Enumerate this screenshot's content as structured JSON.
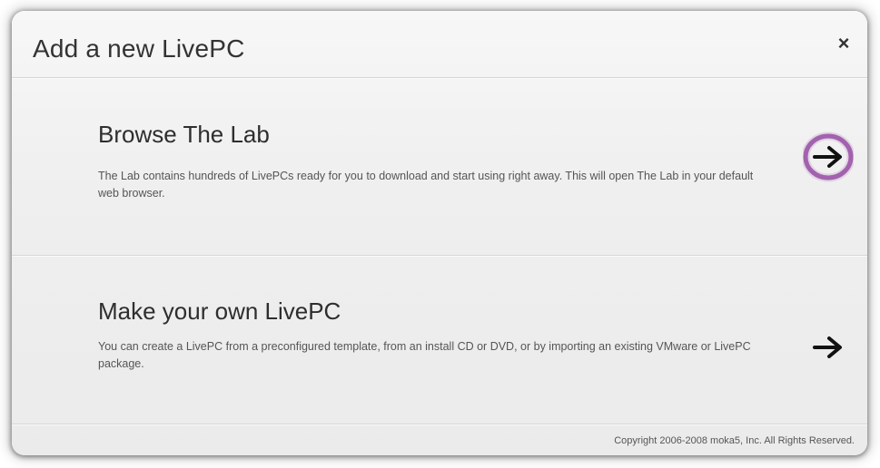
{
  "dialog": {
    "title": "Add a new LivePC",
    "close_label": "×"
  },
  "options": [
    {
      "title": "Browse The Lab",
      "description": "The Lab contains hundreds of LivePCs ready for you to download and start using right away.  This will open The Lab in your default web browser.",
      "arrow_icon": "arrow-right-icon",
      "highlighted": true
    },
    {
      "title": "Make your own LivePC",
      "description": "You can create a LivePC from a preconfigured template, from an install CD or DVD, or by importing an existing VMware or LivePC package.",
      "arrow_icon": "arrow-right-icon",
      "highlighted": false
    }
  ],
  "footer": {
    "copyright": "Copyright 2006-2008 moka5, Inc. All Rights Reserved."
  },
  "colors": {
    "highlight_ring": "#8e3d9b",
    "arrow": "#111111"
  }
}
